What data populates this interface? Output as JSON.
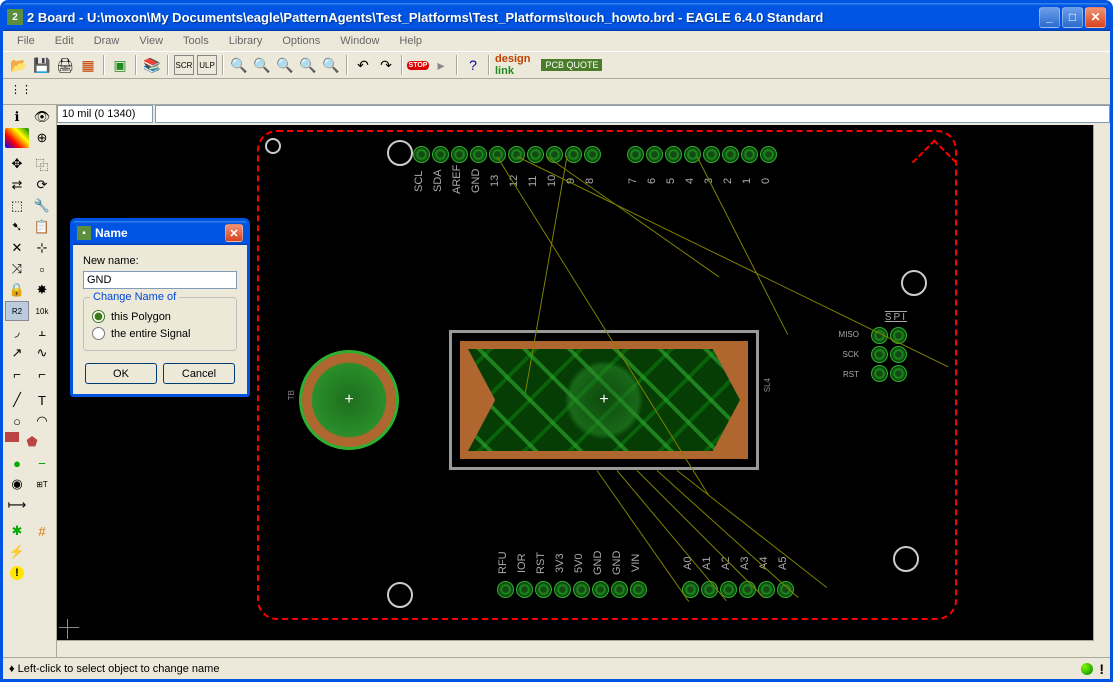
{
  "window": {
    "title": "2 Board - U:\\moxon\\My Documents\\eagle\\PatternAgents\\Test_Platforms\\Test_Platforms\\touch_howto.brd - EAGLE 6.4.0 Standard"
  },
  "menu": {
    "items": [
      "File",
      "Edit",
      "Draw",
      "View",
      "Tools",
      "Library",
      "Options",
      "Window",
      "Help"
    ]
  },
  "actionbar": {
    "grid": "⋮⋮"
  },
  "coord": "10 mil (0 1340)",
  "toolbar": {
    "dl_design": "design",
    "dl_link": "link",
    "pcb_quote": "PCB QUOTE"
  },
  "pcb": {
    "top_pins_a": [
      "SCL",
      "SDA",
      "AREF",
      "GND",
      "13",
      "12",
      "11",
      "10",
      "9",
      "8"
    ],
    "top_pins_b": [
      "7",
      "6",
      "5",
      "4",
      "3",
      "2",
      "1",
      "0"
    ],
    "bot_pins_a": [
      "RFU",
      "IOR",
      "RST",
      "3V3",
      "5V0",
      "GND",
      "GND",
      "VIN"
    ],
    "bot_pins_b": [
      "A0",
      "A1",
      "A2",
      "A3",
      "A4",
      "A5"
    ],
    "spi_label": "SPI",
    "spi_pins": [
      "MISO",
      "SCK",
      "RST"
    ],
    "tb_label": "TB",
    "sl_label": "SL4"
  },
  "dialog": {
    "title": "Name",
    "label_newname": "New name:",
    "input_value": "GND",
    "group_title": "Change Name of",
    "radio1": "this Polygon",
    "radio2": "the entire Signal",
    "ok": "OK",
    "cancel": "Cancel"
  },
  "status": {
    "text": "♦ Left-click to select object to change name",
    "excl": "!"
  }
}
